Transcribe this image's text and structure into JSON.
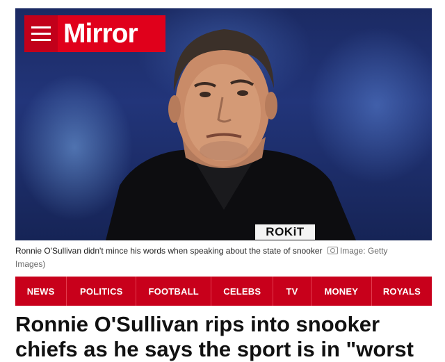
{
  "brand": {
    "name": "Mirror",
    "color": "#e0001b"
  },
  "hero": {
    "sponsor_text": "ROKiT"
  },
  "caption": {
    "text": "Ronnie O'Sullivan didn't mince his words when speaking about the state of snooker",
    "credit_icon": "camera-icon",
    "credit": "Image: Getty Images)"
  },
  "nav": {
    "items": [
      {
        "label": "NEWS"
      },
      {
        "label": "POLITICS"
      },
      {
        "label": "FOOTBALL"
      },
      {
        "label": "CELEBS"
      },
      {
        "label": "TV"
      },
      {
        "label": "MONEY"
      },
      {
        "label": "ROYALS"
      }
    ],
    "color": "#c8001b"
  },
  "article": {
    "headline": "Ronnie O'Sullivan rips into snooker chiefs as he says the sport is in \"worst"
  }
}
